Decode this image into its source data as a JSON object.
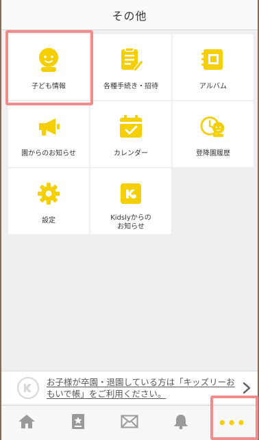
{
  "header": {
    "title": "その他"
  },
  "menu": [
    {
      "label": "子ども情報",
      "icon": "child-face-icon"
    },
    {
      "label": "各種手続き・招待",
      "icon": "clipboard-pen-icon"
    },
    {
      "label": "アルバム",
      "icon": "album-icon"
    },
    {
      "label": "園からのお知らせ",
      "icon": "megaphone-icon"
    },
    {
      "label": "カレンダー",
      "icon": "calendar-check-icon"
    },
    {
      "label": "登降園履歴",
      "icon": "clock-child-icon"
    },
    {
      "label": "設定",
      "icon": "gear-icon"
    },
    {
      "label_line1": "Kidslyからの",
      "label_line2": "お知らせ",
      "icon": "kidsly-logo-icon"
    }
  ],
  "notice": {
    "text": "お子様が卒園・退園している方は「キッズリーおもいで帳」をご利用ください。"
  },
  "tabbar": [
    {
      "name": "home",
      "icon": "home-icon"
    },
    {
      "name": "bookmark",
      "icon": "bookmark-star-icon"
    },
    {
      "name": "messages",
      "icon": "envelope-icon"
    },
    {
      "name": "notifications",
      "icon": "bell-icon"
    },
    {
      "name": "more",
      "icon": "more-dots-icon",
      "label": "•••"
    }
  ],
  "colors": {
    "accent": "#f5cf00",
    "highlight": "#f28c8c",
    "frame": "#8b6a4f"
  }
}
